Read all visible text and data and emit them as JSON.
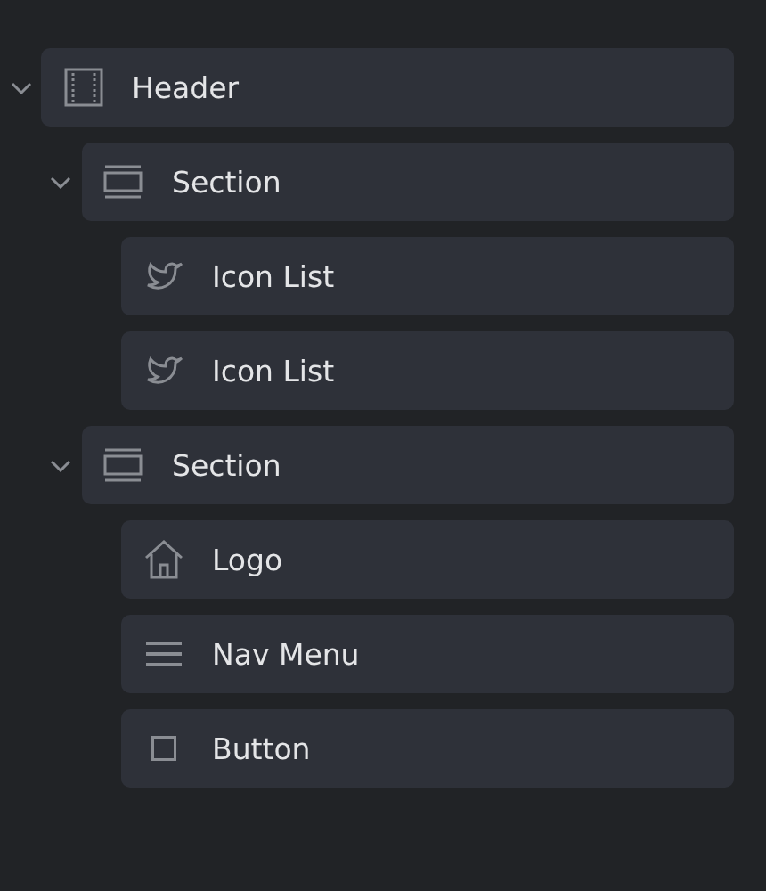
{
  "tree": [
    {
      "kind": "header",
      "label": "Header",
      "expanded": true,
      "children": [
        {
          "kind": "section",
          "label": "Section",
          "expanded": true,
          "children": [
            {
              "kind": "icon-list",
              "label": "Icon List"
            },
            {
              "kind": "icon-list",
              "label": "Icon List"
            }
          ]
        },
        {
          "kind": "section",
          "label": "Section",
          "expanded": true,
          "children": [
            {
              "kind": "logo",
              "label": "Logo"
            },
            {
              "kind": "nav-menu",
              "label": "Nav Menu"
            },
            {
              "kind": "button",
              "label": "Button"
            }
          ]
        }
      ]
    }
  ]
}
